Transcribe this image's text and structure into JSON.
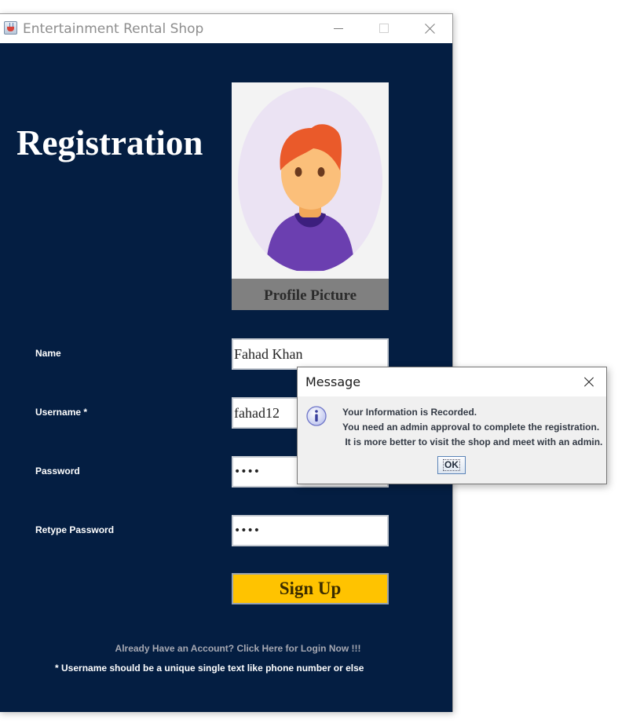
{
  "window": {
    "title": "Entertainment Rental Shop",
    "app_icon": "java-cup-icon"
  },
  "form": {
    "heading": "Registration",
    "profile_picture": {
      "avatar": "user-avatar-icon",
      "caption": "Profile Picture"
    },
    "fields": {
      "name": {
        "label": "Name",
        "value": "Fahad Khan"
      },
      "username": {
        "label": "Username *",
        "value": "fahad12"
      },
      "password": {
        "label": "Password",
        "value": "••••"
      },
      "retype_password": {
        "label": "Retype Password",
        "value": "••••"
      }
    },
    "signup_label": "Sign Up",
    "login_link": "Already Have an Account? Click Here for Login Now !!!",
    "username_note": "* Username should be a unique single text like phone number or else"
  },
  "dialog": {
    "title": "Message",
    "icon": "info-icon",
    "lines": [
      "Your Information is Recorded.",
      "You need an admin approval to complete the registration.",
      " It is more better to visit the shop and meet with an admin."
    ],
    "ok_label": "OK"
  },
  "colors": {
    "background": "#041e42",
    "button": "#ffc300",
    "caption_bar": "#808080"
  }
}
